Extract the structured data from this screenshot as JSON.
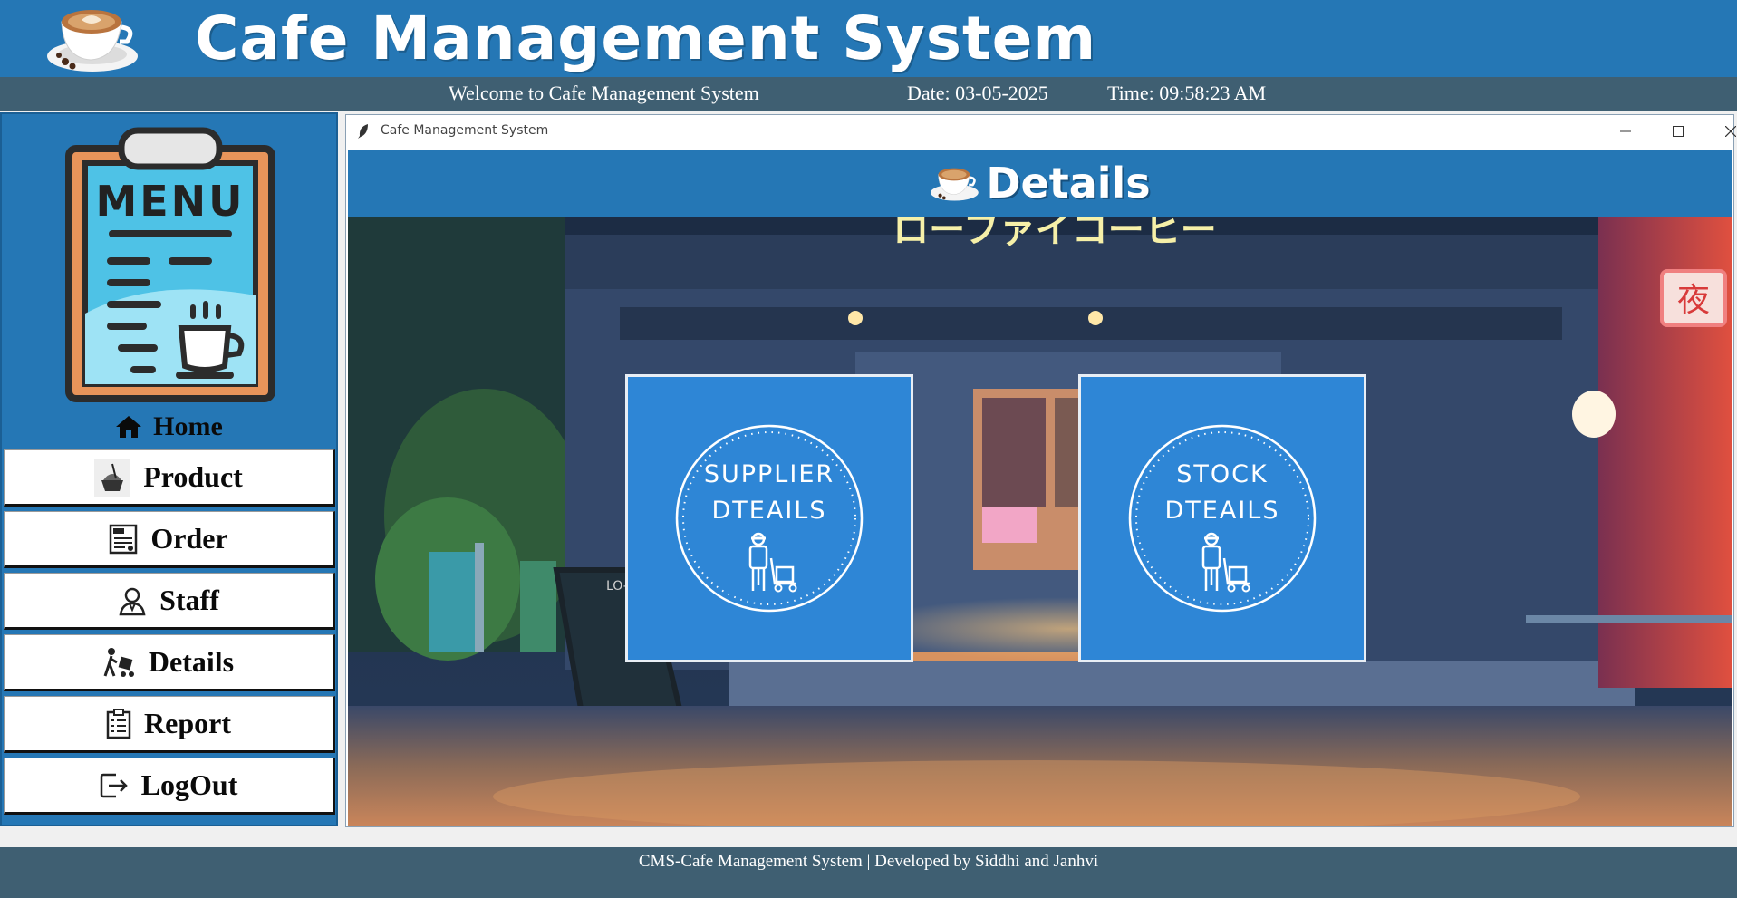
{
  "header": {
    "title": "Cafe Management System"
  },
  "statusbar": {
    "welcome": "Welcome to Cafe Management System",
    "date": "Date: 03-05-2025",
    "time": "Time: 09:58:23 AM"
  },
  "sidebar": {
    "logo_text": "MENU",
    "home_label": "Home",
    "items": [
      {
        "label": "Product",
        "icon": "product-icon"
      },
      {
        "label": "Order",
        "icon": "bill-icon"
      },
      {
        "label": "Staff",
        "icon": "staff-icon"
      },
      {
        "label": "Details",
        "icon": "delivery-icon"
      },
      {
        "label": "Report",
        "icon": "report-icon"
      },
      {
        "label": "LogOut",
        "icon": "logout-icon"
      }
    ]
  },
  "window": {
    "title": "Cafe Management System",
    "header_title": "Details",
    "sign_text": "ローファイコーヒー",
    "neon_sign": "夜",
    "board_title": "LO-FI COFFEE",
    "cards": [
      {
        "line1": "SUPPLIER",
        "line2": "DTEAILS"
      },
      {
        "line1": "STOCK",
        "line2": "DTEAILS"
      }
    ]
  },
  "footer": {
    "text": "CMS-Cafe Management System | Developed by Siddhi and Janhvi"
  },
  "colors": {
    "header_bg": "#2577b5",
    "statusbar_bg": "#3f5f72",
    "card_bg": "#2e86d6"
  }
}
